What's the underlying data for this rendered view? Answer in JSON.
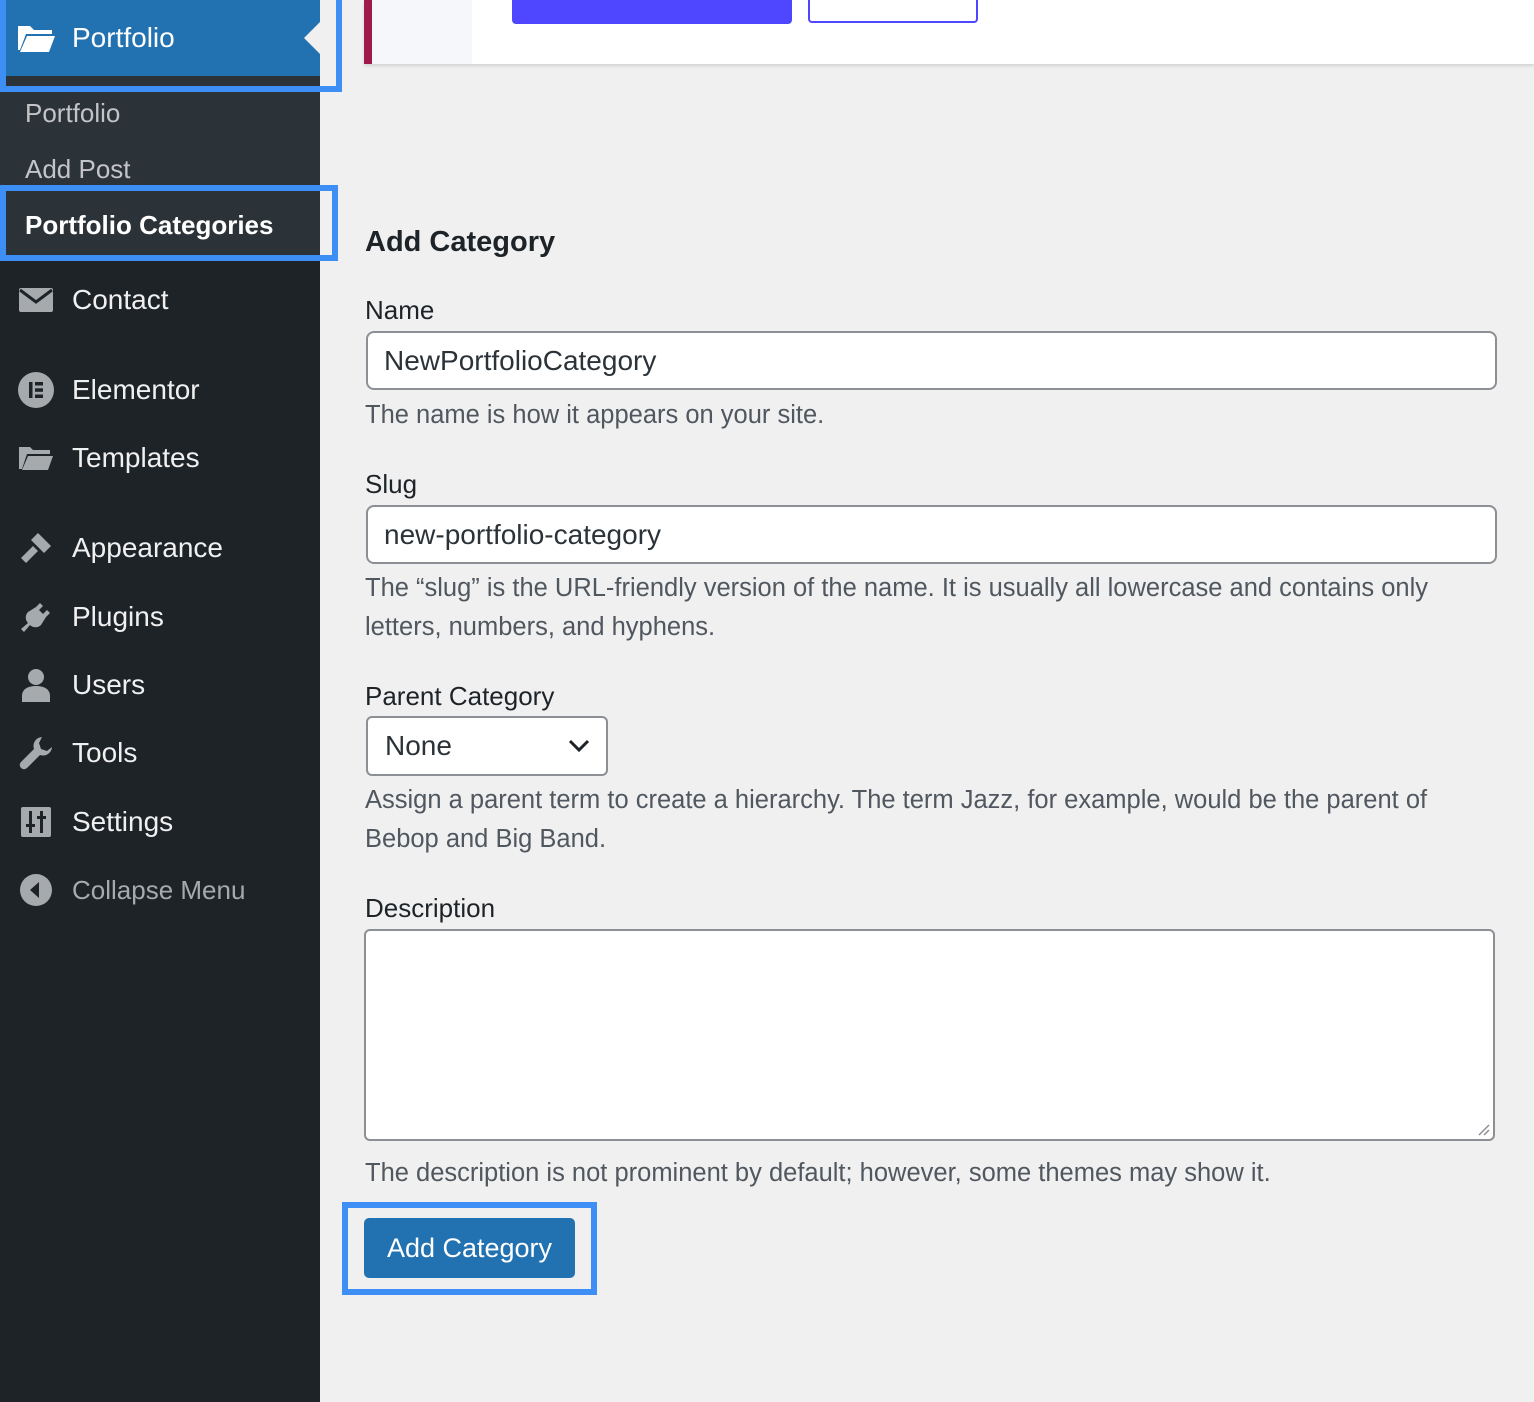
{
  "sidebar": {
    "current_menu": {
      "label": "Portfolio",
      "icon": "folder-open-icon"
    },
    "submenu": [
      {
        "label": "Portfolio",
        "current": false
      },
      {
        "label": "Add Post",
        "current": false
      },
      {
        "label": "Portfolio Categories",
        "current": true
      }
    ],
    "items": [
      {
        "label": "Contact",
        "icon": "envelope-icon"
      },
      {
        "label": "Elementor",
        "icon": "elementor-icon"
      },
      {
        "label": "Templates",
        "icon": "folder-icon"
      },
      {
        "label": "Appearance",
        "icon": "paintbrush-icon"
      },
      {
        "label": "Plugins",
        "icon": "plug-icon"
      },
      {
        "label": "Users",
        "icon": "user-icon"
      },
      {
        "label": "Tools",
        "icon": "wrench-icon"
      },
      {
        "label": "Settings",
        "icon": "sliders-icon"
      },
      {
        "label": "Collapse Menu",
        "icon": "collapse-arrow-icon"
      }
    ]
  },
  "form": {
    "heading": "Add Category",
    "name": {
      "label": "Name",
      "value": "NewPortfolioCategory",
      "help": "The name is how it appears on your site."
    },
    "slug": {
      "label": "Slug",
      "value": "new-portfolio-category",
      "help": "The “slug” is the URL-friendly version of the name. It is usually all lowercase and contains only letters, numbers, and hyphens."
    },
    "parent": {
      "label": "Parent Category",
      "selected": "None",
      "help": "Assign a parent term to create a hierarchy. The term Jazz, for example, would be the parent of Bebop and Big Band."
    },
    "description": {
      "label": "Description",
      "value": "",
      "help": "The description is not prominent by default; however, some themes may show it."
    },
    "submit_label": "Add Category"
  },
  "colors": {
    "sidebar_bg": "#1d2327",
    "submenu_bg": "#2c3338",
    "accent": "#2271b1",
    "highlight": "#3d8ff5",
    "notice_button": "#4f46ff"
  }
}
